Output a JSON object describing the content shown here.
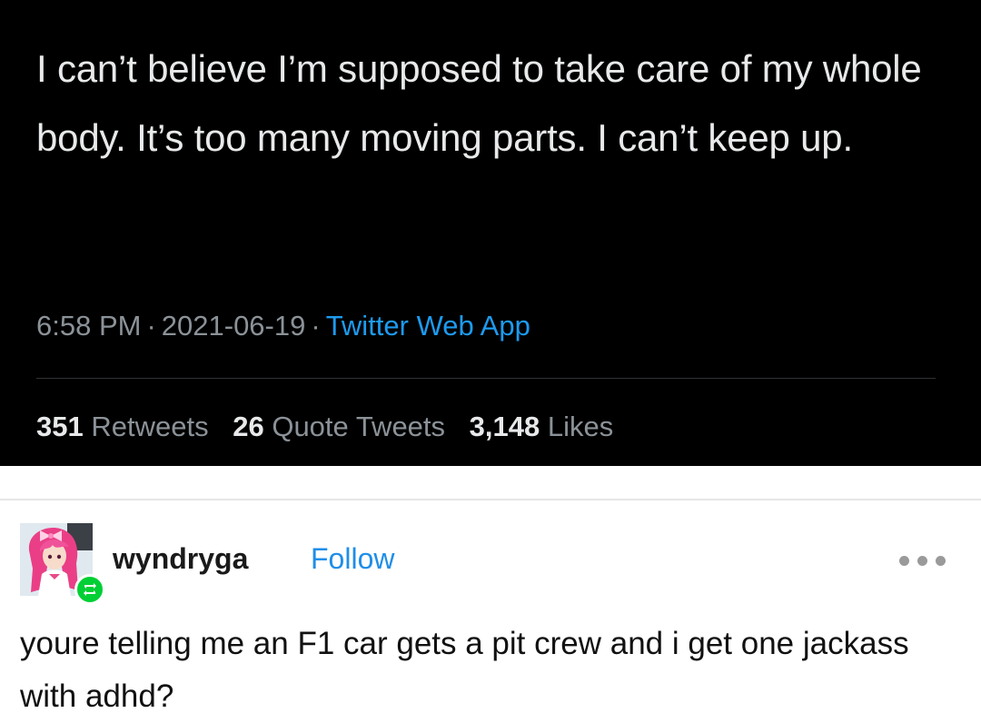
{
  "tweet": {
    "text": "I can’t believe I’m supposed to take care of my whole body. It’s too many moving parts. I can’t keep up.",
    "time": "6:58 PM",
    "date": "2021-06-19",
    "separator": "·",
    "app": "Twitter Web App",
    "stats": {
      "retweets_count": "351",
      "retweets_label": "Retweets",
      "quotes_count": "26",
      "quotes_label": "Quote Tweets",
      "likes_count": "3,148",
      "likes_label": "Likes"
    }
  },
  "tumblr": {
    "username": "wyndryga",
    "follow_label": "Follow",
    "post_text": "youre telling me an F1 car gets a pit crew and i get one jackass with adhd?",
    "more_icon": "ellipsis-icon",
    "reblog_icon": "reblog-icon",
    "colors": {
      "follow": "#1f8ee8",
      "reblog_badge": "#00cf35"
    }
  }
}
